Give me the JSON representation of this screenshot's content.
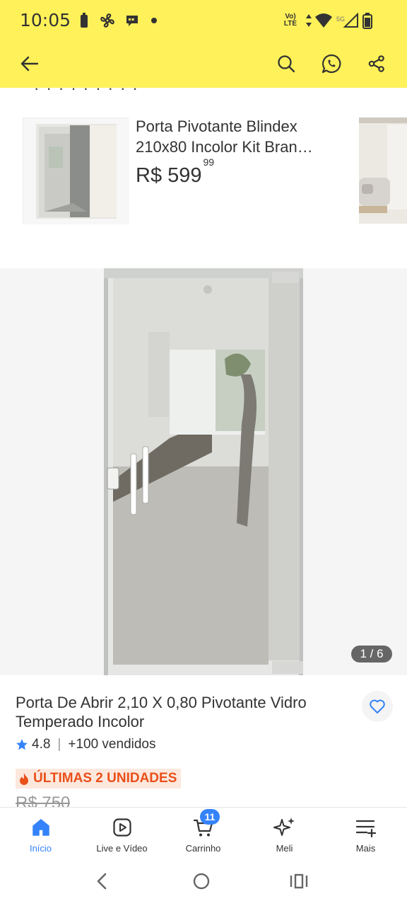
{
  "status_bar": {
    "time": "10:05",
    "network_label": "Vo) LTE",
    "network_5g": "5G"
  },
  "app_bar": {
    "back_icon": "arrow-left-icon",
    "search_icon": "search-icon",
    "whatsapp_icon": "whatsapp-icon",
    "share_icon": "share-icon"
  },
  "related_product": {
    "title": "Porta Pivotante Blindex 210x80 Incolor Kit Bran…",
    "price_main": "R$ 599",
    "price_cents": "99"
  },
  "gallery": {
    "counter": "1 / 6"
  },
  "product": {
    "title": "Porta De Abrir 2,10 X 0,80 Pivotante Vidro Temperado Incolor",
    "rating": "4.8",
    "sold": "+100 vendidos",
    "stock_badge": "ÚLTIMAS 2 UNIDADES",
    "old_price": "R$ 750"
  },
  "bottom_nav": {
    "items": [
      {
        "label": "Início",
        "icon": "home-icon"
      },
      {
        "label": "Live e Vídeo",
        "icon": "play-icon"
      },
      {
        "label": "Carrinho",
        "icon": "cart-icon"
      },
      {
        "label": "Meli",
        "icon": "sparkle-icon"
      },
      {
        "label": "Mais",
        "icon": "menu-plus-icon"
      }
    ],
    "cart_count": "11"
  },
  "colors": {
    "header_bg": "#FFF159",
    "accent_blue": "#3483FA",
    "badge_orange": "#E9501A",
    "badge_bg": "#FDE8DE"
  }
}
